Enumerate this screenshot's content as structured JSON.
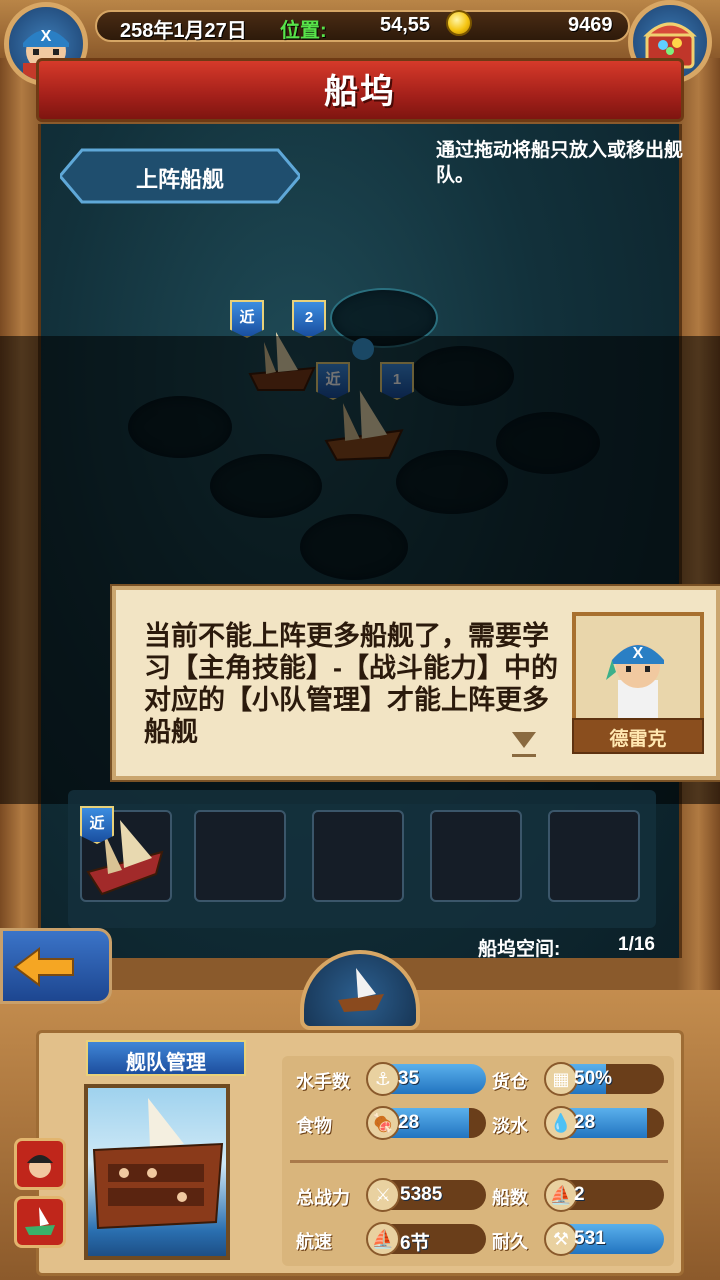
{
  "topbar": {
    "date": "258年1月27日",
    "position_label": "位置:",
    "position_value": "54,55",
    "gold": "9469"
  },
  "page_title": "船坞",
  "lineup_tab": "上阵船舰",
  "hint": "通过拖动将船只放入或移出舰队。",
  "ships": [
    {
      "range": "近",
      "index": "2"
    },
    {
      "range": "近",
      "index": "1"
    }
  ],
  "fleet_slot_badge": "近",
  "dialog": {
    "text": "当前不能上阵更多船舰了，需要学习【主角技能】-【战斗能力】中的对应的【小队管理】才能上阵更多船舰",
    "speaker": "德雷克"
  },
  "dock_space": {
    "label": "船坞空间:",
    "value": "1/16"
  },
  "fleet_management": "舰队管理",
  "stats": {
    "sailors": {
      "label": "水手数",
      "value": "35",
      "fill": 1.0
    },
    "cargo": {
      "label": "货仓",
      "value": "50%",
      "fill": 0.5
    },
    "food": {
      "label": "食物",
      "value": "28",
      "fill": 0.85
    },
    "water": {
      "label": "淡水",
      "value": "28",
      "fill": 0.85
    },
    "power": {
      "label": "总战力",
      "value": "5385",
      "fill": 0
    },
    "ship_count": {
      "label": "船数",
      "value": "2",
      "fill": 0
    },
    "speed": {
      "label": "航速",
      "value": "6节",
      "fill": 0
    },
    "durability": {
      "label": "耐久",
      "value": "531",
      "fill": 1.0
    }
  },
  "colors": {
    "accent_green": "#58e34a",
    "banner_red": "#c0261b",
    "bar_blue": "#2274c0"
  }
}
